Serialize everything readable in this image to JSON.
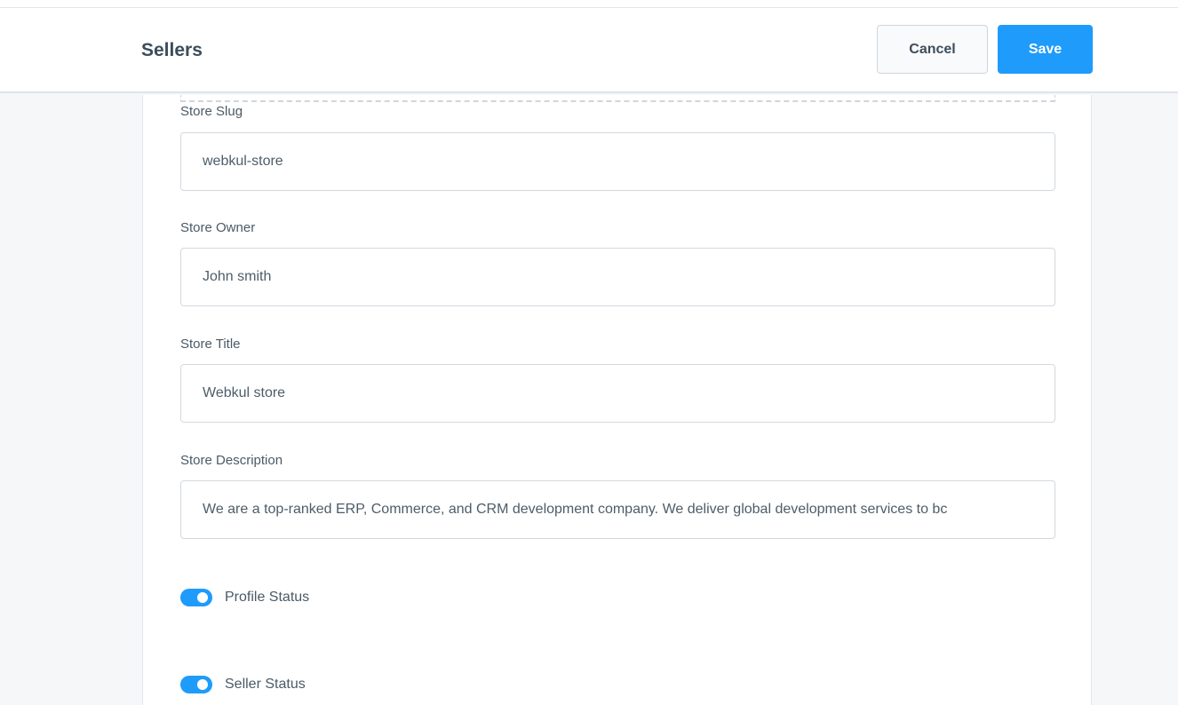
{
  "header": {
    "title": "Sellers",
    "cancel_label": "Cancel",
    "save_label": "Save"
  },
  "form": {
    "store_slug": {
      "label": "Store Slug",
      "value": "webkul-store"
    },
    "store_owner": {
      "label": "Store Owner",
      "value": "John smith"
    },
    "store_title": {
      "label": "Store Title",
      "value": "Webkul store"
    },
    "store_description": {
      "label": "Store Description",
      "value": "We are a top-ranked ERP, Commerce, and CRM development company. We deliver global development services to bc"
    },
    "profile_status": {
      "label": "Profile Status",
      "enabled": true
    },
    "seller_status": {
      "label": "Seller Status",
      "enabled": true
    }
  },
  "colors": {
    "accent": "#1e9bfb",
    "background": "#f5f7f9"
  }
}
